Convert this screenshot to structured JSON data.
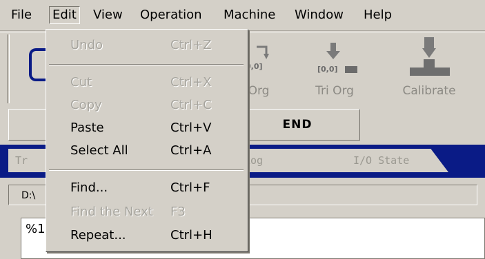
{
  "menubar": {
    "file": "File",
    "edit": "Edit",
    "view": "View",
    "operation": "Operation",
    "machine": "Machine",
    "window": "Window",
    "help": "Help"
  },
  "toolbar": {
    "org_label": "Org",
    "tri_org_label": "Tri Org",
    "calibrate_label": "Calibrate",
    "coord_a": "0,0]",
    "coord_b": "[0,0]"
  },
  "controls": {
    "end_label": "END"
  },
  "tabs": {
    "tr": "Tr",
    "log": "Log",
    "io_state": "I/O State"
  },
  "path": {
    "prefix": "D:\\"
  },
  "editor": {
    "line1": "%1"
  },
  "edit_menu": {
    "undo": {
      "label": "Undo",
      "shortcut": "Ctrl+Z"
    },
    "cut": {
      "label": "Cut",
      "shortcut": "Ctrl+X"
    },
    "copy": {
      "label": "Copy",
      "shortcut": "Ctrl+C"
    },
    "paste": {
      "label": "Paste",
      "shortcut": "Ctrl+V"
    },
    "select_all": {
      "label": "Select All",
      "shortcut": "Ctrl+A"
    },
    "find": {
      "label": "Find...",
      "shortcut": "Ctrl+F"
    },
    "find_next": {
      "label": "Find the Next",
      "shortcut": "F3"
    },
    "repeat": {
      "label": "Repeat...",
      "shortcut": "Ctrl+H"
    }
  }
}
